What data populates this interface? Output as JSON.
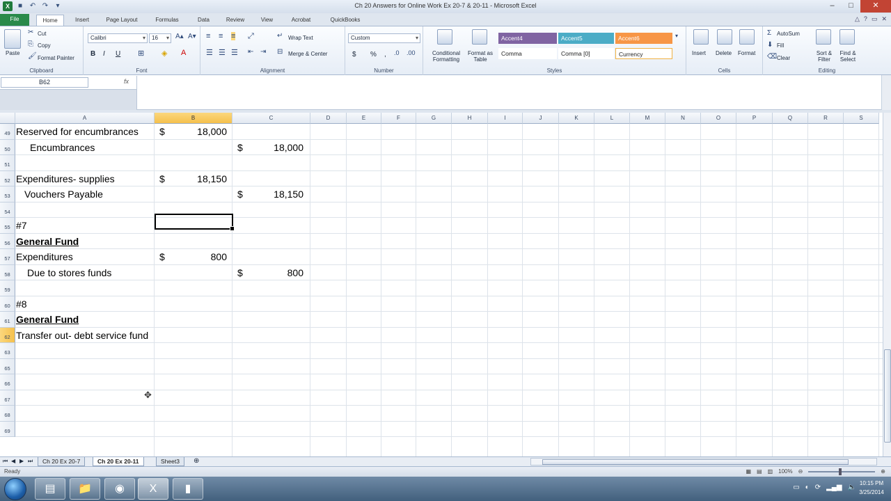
{
  "window": {
    "title": "Ch 20 Answers for Online Work Ex 20-7 & 20-11 - Microsoft Excel"
  },
  "tabs": [
    "File",
    "Home",
    "Insert",
    "Page Layout",
    "Formulas",
    "Data",
    "Review",
    "View",
    "Acrobat",
    "QuickBooks"
  ],
  "ribbon": {
    "clipboard": {
      "paste": "Paste",
      "cut": "Cut",
      "copy": "Copy",
      "format_painter": "Format Painter",
      "label": "Clipboard"
    },
    "font": {
      "name": "Calibri",
      "size": "16",
      "label": "Font",
      "bold": "B",
      "italic": "I",
      "underline": "U"
    },
    "alignment": {
      "wrap": "Wrap Text",
      "merge": "Merge & Center",
      "label": "Alignment"
    },
    "number": {
      "format": "Custom",
      "currency": "$",
      "percent": "%",
      "comma": ",",
      "label": "Number"
    },
    "styles": {
      "conditional": "Conditional Formatting",
      "format_table": "Format as Table",
      "accent4": "Accent4",
      "accent5": "Accent5",
      "accent6": "Accent6",
      "comma": "Comma",
      "comma0": "Comma [0]",
      "currency": "Currency",
      "label": "Styles",
      "accent4_color": "#8064a2",
      "accent5_color": "#4bacc6",
      "accent6_color": "#f79646"
    },
    "cells": {
      "insert": "Insert",
      "delete": "Delete",
      "format": "Format",
      "label": "Cells"
    },
    "editing": {
      "autosum": "AutoSum",
      "fill": "Fill",
      "clear": "Clear",
      "sort": "Sort & Filter",
      "find": "Find & Select",
      "label": "Editing"
    }
  },
  "formula_bar": {
    "name_box": "B62",
    "fx": "fx",
    "content": ""
  },
  "columns": [
    "A",
    "B",
    "C",
    "D",
    "E",
    "F",
    "G",
    "H",
    "I",
    "J",
    "K",
    "L",
    "M",
    "N",
    "O",
    "P",
    "Q",
    "R",
    "S"
  ],
  "selected_column": "B",
  "rows": [
    {
      "num": "49",
      "a": "Reserved for encumbrances",
      "a_indent": 0,
      "b_sym": "$",
      "b_val": "18,000",
      "c_sym": "",
      "c_val": ""
    },
    {
      "num": "50",
      "a": "Encumbrances",
      "a_indent": 20,
      "b_sym": "",
      "b_val": "",
      "c_sym": "$",
      "c_val": "18,000"
    },
    {
      "num": "51",
      "a": "",
      "a_indent": 0,
      "b_sym": "",
      "b_val": "",
      "c_sym": "",
      "c_val": ""
    },
    {
      "num": "52",
      "a": "Expenditures- supplies",
      "a_indent": 0,
      "b_sym": "$",
      "b_val": "18,150",
      "c_sym": "",
      "c_val": ""
    },
    {
      "num": "53",
      "a": "Vouchers Payable",
      "a_indent": 12,
      "b_sym": "",
      "b_val": "",
      "c_sym": "$",
      "c_val": "18,150"
    },
    {
      "num": "54",
      "a": "",
      "a_indent": 0,
      "b_sym": "",
      "b_val": "",
      "c_sym": "",
      "c_val": ""
    },
    {
      "num": "55",
      "a": "#7",
      "a_indent": 0,
      "b_sym": "",
      "b_val": "",
      "c_sym": "",
      "c_val": ""
    },
    {
      "num": "56",
      "a": "General Fund",
      "a_indent": 0,
      "bold": true,
      "b_sym": "",
      "b_val": "",
      "c_sym": "",
      "c_val": ""
    },
    {
      "num": "57",
      "a": "Expenditures",
      "a_indent": 0,
      "b_sym": "$",
      "b_val": "800",
      "c_sym": "",
      "c_val": ""
    },
    {
      "num": "58",
      "a": "Due to stores funds",
      "a_indent": 16,
      "b_sym": "",
      "b_val": "",
      "c_sym": "$",
      "c_val": "800"
    },
    {
      "num": "59",
      "a": "",
      "a_indent": 0,
      "b_sym": "",
      "b_val": "",
      "c_sym": "",
      "c_val": ""
    },
    {
      "num": "60",
      "a": "#8",
      "a_indent": 0,
      "b_sym": "",
      "b_val": "",
      "c_sym": "",
      "c_val": ""
    },
    {
      "num": "61",
      "a": "General Fund",
      "a_indent": 0,
      "bold": true,
      "b_sym": "",
      "b_val": "",
      "c_sym": "",
      "c_val": ""
    },
    {
      "num": "62",
      "a": "Transfer out- debt service fund",
      "a_indent": 0,
      "b_sym": "",
      "b_val": "",
      "c_sym": "",
      "c_val": ""
    },
    {
      "num": "63",
      "a": "",
      "a_indent": 0
    },
    {
      "num": "65",
      "a": "",
      "a_indent": 0
    },
    {
      "num": "66",
      "a": "",
      "a_indent": 0
    },
    {
      "num": "67",
      "a": "",
      "a_indent": 0
    },
    {
      "num": "68",
      "a": "",
      "a_indent": 0
    },
    {
      "num": "69",
      "a": "",
      "a_indent": 0
    }
  ],
  "sheet_tabs": [
    "Ch 20 Ex 20-7",
    "Ch 20 Ex 20-11",
    "Sheet3"
  ],
  "active_sheet": "Ch 20 Ex 20-11",
  "status": {
    "ready": "Ready",
    "zoom": "100%"
  },
  "clock": {
    "time": "10:15 PM",
    "date": "3/25/2014"
  }
}
